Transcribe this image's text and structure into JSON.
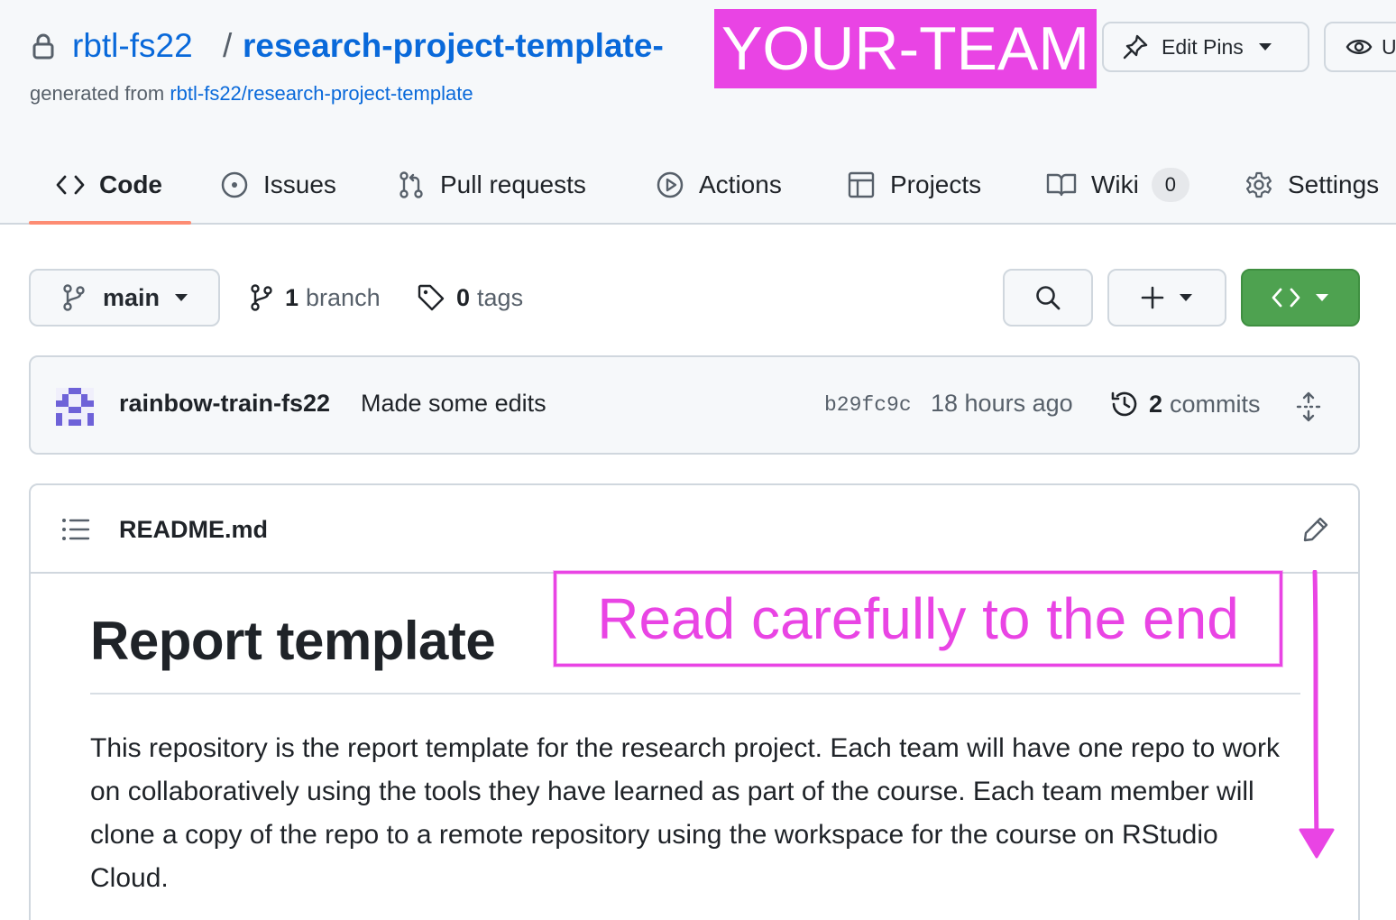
{
  "header": {
    "owner": "rbtl-fs22",
    "separator": "/",
    "repo_name": "research-project-template-",
    "team_placeholder": "YOUR-TEAM",
    "generated_prefix": "generated from ",
    "generated_source": "rbtl-fs22/research-project-template",
    "edit_pins_label": "Edit Pins",
    "watch_label_partial": "U"
  },
  "tabs": [
    {
      "label": "Code",
      "icon": "code-icon",
      "selected": true
    },
    {
      "label": "Issues",
      "icon": "issue-opened-icon"
    },
    {
      "label": "Pull requests",
      "icon": "git-pull-request-icon"
    },
    {
      "label": "Actions",
      "icon": "play-icon"
    },
    {
      "label": "Projects",
      "icon": "table-icon"
    },
    {
      "label": "Wiki",
      "icon": "book-icon",
      "count": "0"
    },
    {
      "label": "Settings",
      "icon": "gear-icon"
    }
  ],
  "branch_bar": {
    "current_branch": "main",
    "branch_count": "1",
    "branch_label": "branch",
    "tag_count": "0",
    "tag_label": "tags"
  },
  "latest_commit": {
    "author": "rainbow-train-fs22",
    "message": "Made some edits",
    "sha": "b29fc9c",
    "time": "18 hours ago",
    "commit_count": "2",
    "commit_label": "commits"
  },
  "readme": {
    "filename": "README.md",
    "title": "Report template",
    "paragraph": "This repository is the report template for the research project. Each team will have one repo to work on collaboratively using the tools they have learned as part of the course. Each team member will clone a copy of the repo to a remote repository using the workspace for the course on RStudio Cloud."
  },
  "annotation": {
    "text": "Read carefully to the end",
    "color": "#e944e4"
  },
  "colors": {
    "link": "#0969da",
    "code_button": "#4ea250",
    "tab_underline": "#fd8c73",
    "highlight": "#e944e4"
  }
}
